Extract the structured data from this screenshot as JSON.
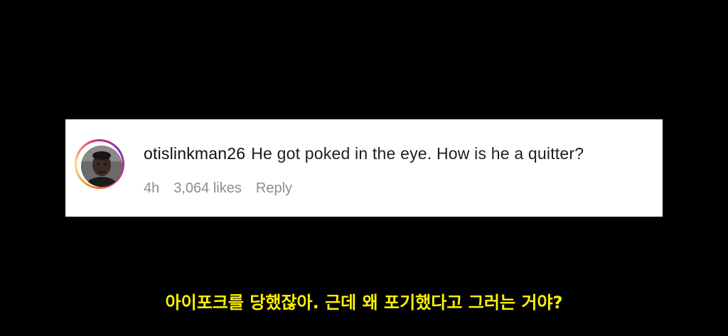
{
  "comment": {
    "username": "otislinkman26",
    "text": "He got poked in the eye. How is he a quitter?",
    "age": "4h",
    "likes": "3,064 likes",
    "reply_label": "Reply"
  },
  "subtitle": {
    "text": "아이포크를 당했잖아. 근데 왜 포기했다고 그러는 거야?"
  },
  "colors": {
    "background": "#000000",
    "card": "#ffffff",
    "meta_text": "#8e8e8e",
    "subtitle": "#fff200"
  }
}
